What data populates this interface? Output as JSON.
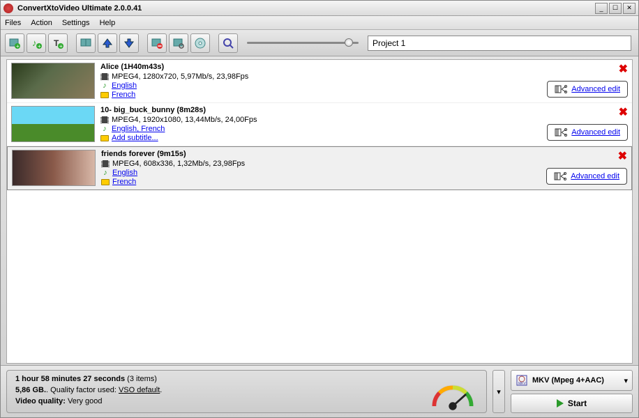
{
  "window": {
    "title": "ConvertXtoVideo Ultimate 2.0.0.41"
  },
  "menu": {
    "files": "Files",
    "action": "Action",
    "settings": "Settings",
    "help": "Help"
  },
  "toolbar": {
    "project_value": "Project 1"
  },
  "items": [
    {
      "title": "Alice (1H40m43s)",
      "video": "MPEG4, 1280x720, 5,97Mb/s, 23,98Fps",
      "audio": "English",
      "subtitle": "French",
      "subtitle_is_link": true
    },
    {
      "title": "10- big_buck_bunny (8m28s)",
      "video": "MPEG4, 1920x1080, 13,44Mb/s, 24,00Fps",
      "audio": "English, French",
      "subtitle": "Add subtitle...",
      "subtitle_is_link": true
    },
    {
      "title": "friends forever (9m15s)",
      "video": "MPEG4, 608x336, 1,32Mb/s, 23,98Fps",
      "audio": "English",
      "subtitle": "French",
      "subtitle_is_link": true,
      "selected": true
    }
  ],
  "advanced_edit_label": "Advanced edit",
  "status": {
    "duration_bold": "1 hour 58 minutes 27 seconds",
    "duration_count": " (3 items)",
    "size_bold": "5,86 GB.",
    "quality_text": ". Quality factor used: ",
    "quality_link": "VSO default",
    "vq_label": "Video quality:",
    "vq_value": " Very good"
  },
  "format": {
    "label": "MKV (Mpeg 4+AAC)"
  },
  "start_label": "Start"
}
